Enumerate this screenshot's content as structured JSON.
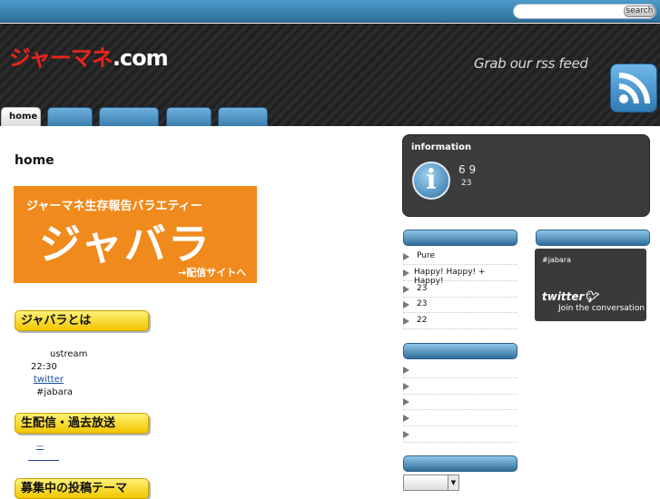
{
  "search": {
    "button_label": "search",
    "placeholder": ""
  },
  "header": {
    "logo_red": "ジャーマネ",
    "logo_white": ".com",
    "rss_text": "Grab our rss feed",
    "rss_icon": "rss-icon"
  },
  "nav": {
    "tabs": [
      {
        "label": "home"
      },
      {
        "label": ""
      },
      {
        "label": ""
      },
      {
        "label": ""
      },
      {
        "label": ""
      }
    ]
  },
  "main": {
    "title": "home",
    "banner": {
      "top_text": "ジャーマネ生存報告バラエティー",
      "main_text": "ジャバラ",
      "link_text": "→配信サイトへ"
    },
    "section1": {
      "heading": "ジャバラとは",
      "ustream": "ustream",
      "time": "22:30",
      "twitter_link": "twitter",
      "hashtag": "#jabara"
    },
    "section2": {
      "heading": "生配信・過去放送",
      "link": "—"
    },
    "section3": {
      "heading": "募集中の投稿テーマ"
    }
  },
  "sidebar": {
    "info": {
      "title": "information",
      "icon_letter": "i",
      "line1": "6 9",
      "line2": "23"
    },
    "list1": [
      {
        "label": "Pure"
      },
      {
        "label": "Happy! Happy! + Happy!"
      },
      {
        "label": "23"
      },
      {
        "label": "23"
      },
      {
        "label": "22"
      }
    ],
    "list2": [
      {
        "label": ""
      },
      {
        "label": ""
      },
      {
        "label": ""
      },
      {
        "label": ""
      },
      {
        "label": ""
      }
    ],
    "twitter": {
      "hashtag": "#jabara",
      "logo": "twitter",
      "join": "Join the conversation"
    },
    "select_value": ""
  },
  "colors": {
    "topbar": "#3a80ad",
    "accent_red": "#e8241c",
    "banner": "#f08a1c",
    "heading_yellow": "#f7d400"
  }
}
